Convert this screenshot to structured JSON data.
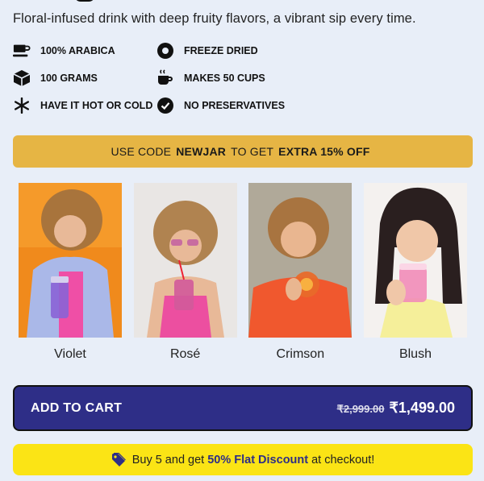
{
  "tagline": "Floral-infused drink with deep fruity flavors, a vibrant sip every time.",
  "features": [
    {
      "icon": "coffee-cup-icon",
      "label": "100% Arabica"
    },
    {
      "icon": "freeze-dried-icon",
      "label": "Freeze Dried"
    },
    {
      "icon": "box-icon",
      "label": "100 Grams"
    },
    {
      "icon": "hot-cup-icon",
      "label": "Makes 50 Cups"
    },
    {
      "icon": "snowflake-icon",
      "label": "Have it hot or cold"
    },
    {
      "icon": "check-circle-icon",
      "label": "No Preservatives"
    }
  ],
  "promo": {
    "prefix": "USE CODE",
    "code": "NEWJAR",
    "middle": "TO GET",
    "offer": "EXTRA 15% OFF",
    "color": "#e6b544"
  },
  "variants": [
    {
      "name": "Violet",
      "bg": "#f08a1c",
      "drink": "#8a63d6"
    },
    {
      "name": "Rosé",
      "bg": "#e9e6e4",
      "drink": "#d25a9a"
    },
    {
      "name": "Crimson",
      "bg": "#b0a999",
      "drink": "#e86a2a"
    },
    {
      "name": "Blush",
      "bg": "#f4f1ef",
      "drink": "#f28cb8"
    }
  ],
  "cart": {
    "label": "ADD TO CART",
    "old_price": "₹2,999.00",
    "new_price": "₹1,499.00",
    "color": "#2e2e87"
  },
  "bulk": {
    "pre": "Buy 5 and get",
    "highlight": "50% Flat Discount",
    "post": "at checkout!",
    "color": "#fbe415"
  }
}
